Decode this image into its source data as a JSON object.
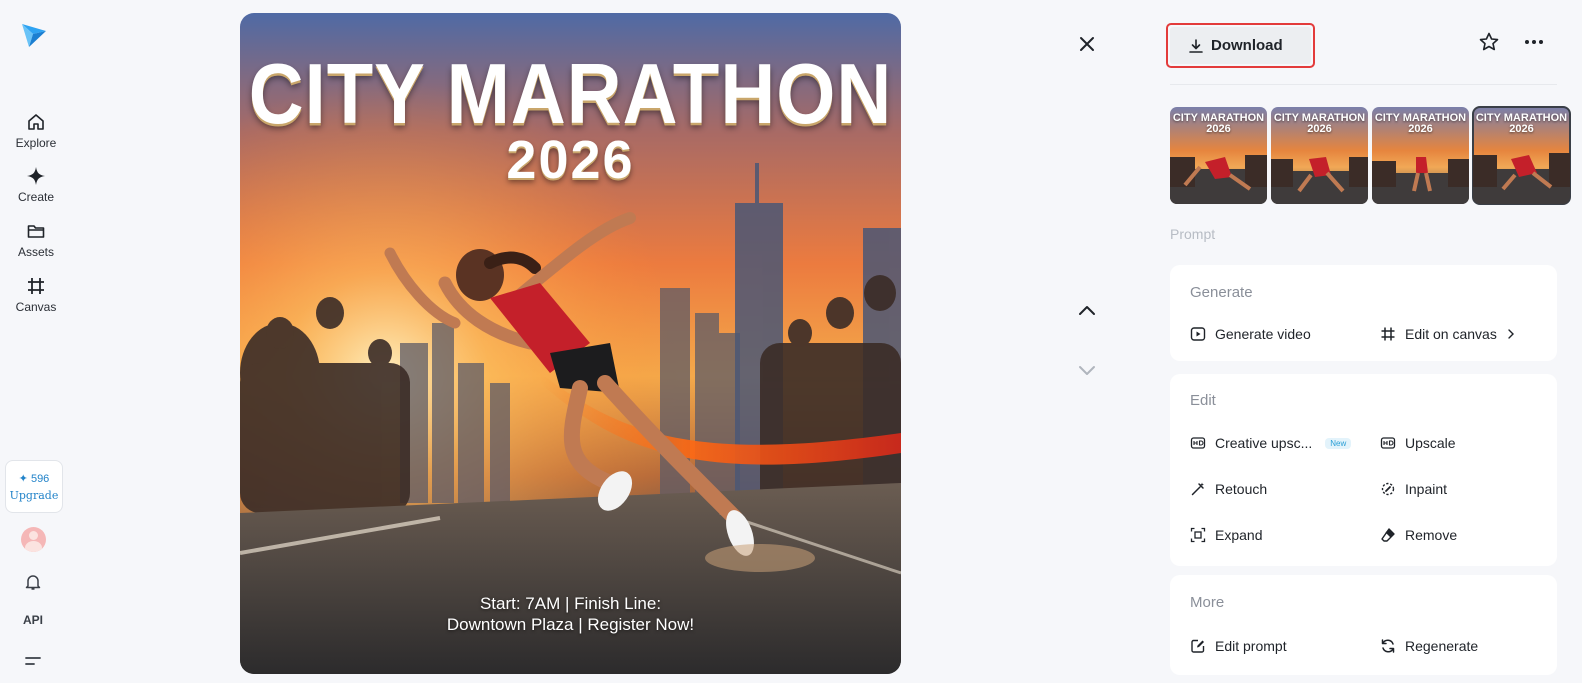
{
  "sidebar": {
    "items": [
      {
        "label": "Explore",
        "icon": "home-icon"
      },
      {
        "label": "Create",
        "icon": "sparkle-icon"
      },
      {
        "label": "Assets",
        "icon": "folder-icon"
      },
      {
        "label": "Canvas",
        "icon": "canvas-icon"
      }
    ],
    "credits": "✦ 596",
    "upgrade_label": "Upgrade",
    "api_label": "API"
  },
  "poster": {
    "title": "CITY MARATHON",
    "year": "2026",
    "footer_line1": "Start: 7AM | Finish Line:",
    "footer_line2": "Downtown Plaza | Register Now!"
  },
  "toolbar": {
    "download_label": "Download"
  },
  "thumbnails": {
    "count_selected_index": 3,
    "items": [
      {
        "title": "CITY MARATHON 2026"
      },
      {
        "title": "CITY MARATHON 2026"
      },
      {
        "title": "CITY MARATHON 2026"
      },
      {
        "title": "CITY MARATHON 2026"
      }
    ]
  },
  "panel": {
    "prompt_label": "Prompt",
    "sections": {
      "generate": {
        "heading": "Generate",
        "generate_video": "Generate video",
        "edit_on_canvas": "Edit on canvas"
      },
      "edit": {
        "heading": "Edit",
        "creative_upscale": "Creative upsc...",
        "new_badge": "New",
        "upscale": "Upscale",
        "retouch": "Retouch",
        "inpaint": "Inpaint",
        "expand": "Expand",
        "remove": "Remove"
      },
      "more": {
        "heading": "More",
        "edit_prompt": "Edit prompt",
        "regenerate": "Regenerate"
      }
    }
  },
  "colors": {
    "accent_blue": "#2283c9",
    "highlight_red": "#e33b3b",
    "background": "#f6f7fa"
  }
}
